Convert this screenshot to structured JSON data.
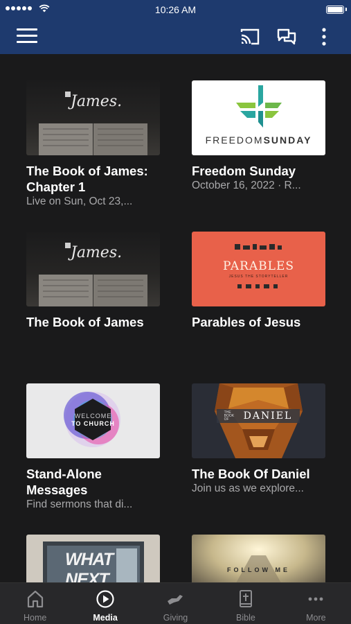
{
  "status_bar": {
    "time": "10:26 AM"
  },
  "header": {
    "menu_icon": "hamburger-menu-icon",
    "cast_icon": "cast-icon",
    "chat_icon": "chat-icon",
    "more_icon": "more-vertical-icon",
    "background": "#1e3a6e"
  },
  "cards": [
    {
      "title": "The Book of James: Chapter 1",
      "subtitle": "Live on Sun, Oct 23,...",
      "thumb_text": "James."
    },
    {
      "title": "Freedom Sunday",
      "subtitle": "October 16, 2022 · R...",
      "thumb_text_a": "FREEDOM",
      "thumb_text_b": "SUNDAY"
    },
    {
      "title": "The Book of James",
      "subtitle": "",
      "thumb_text": "James."
    },
    {
      "title": "Parables of Jesus",
      "subtitle": "",
      "thumb_text": "PARABLES",
      "thumb_subtext": "JESUS THE STORYTELLER"
    },
    {
      "title": "Stand-Alone Messages",
      "subtitle": "Find sermons that di...",
      "thumb_text_a": "WELCOME",
      "thumb_text_b": "TO CHURCH"
    },
    {
      "title": "The Book Of Daniel",
      "subtitle": "Join us as we explore...",
      "thumb_text_a": "THE BOOK OF",
      "thumb_text_b": "DANIEL"
    },
    {
      "title": "",
      "subtitle": "",
      "thumb_text": "WHAT NEXT"
    },
    {
      "title": "",
      "subtitle": "",
      "thumb_text": "FOLLOW ME"
    }
  ],
  "tabs": [
    {
      "label": "Home",
      "icon": "home-icon",
      "active": false
    },
    {
      "label": "Media",
      "icon": "play-circle-icon",
      "active": true
    },
    {
      "label": "Giving",
      "icon": "giving-hand-icon",
      "active": false
    },
    {
      "label": "Bible",
      "icon": "bible-icon",
      "active": false
    },
    {
      "label": "More",
      "icon": "more-horizontal-icon",
      "active": false
    }
  ]
}
